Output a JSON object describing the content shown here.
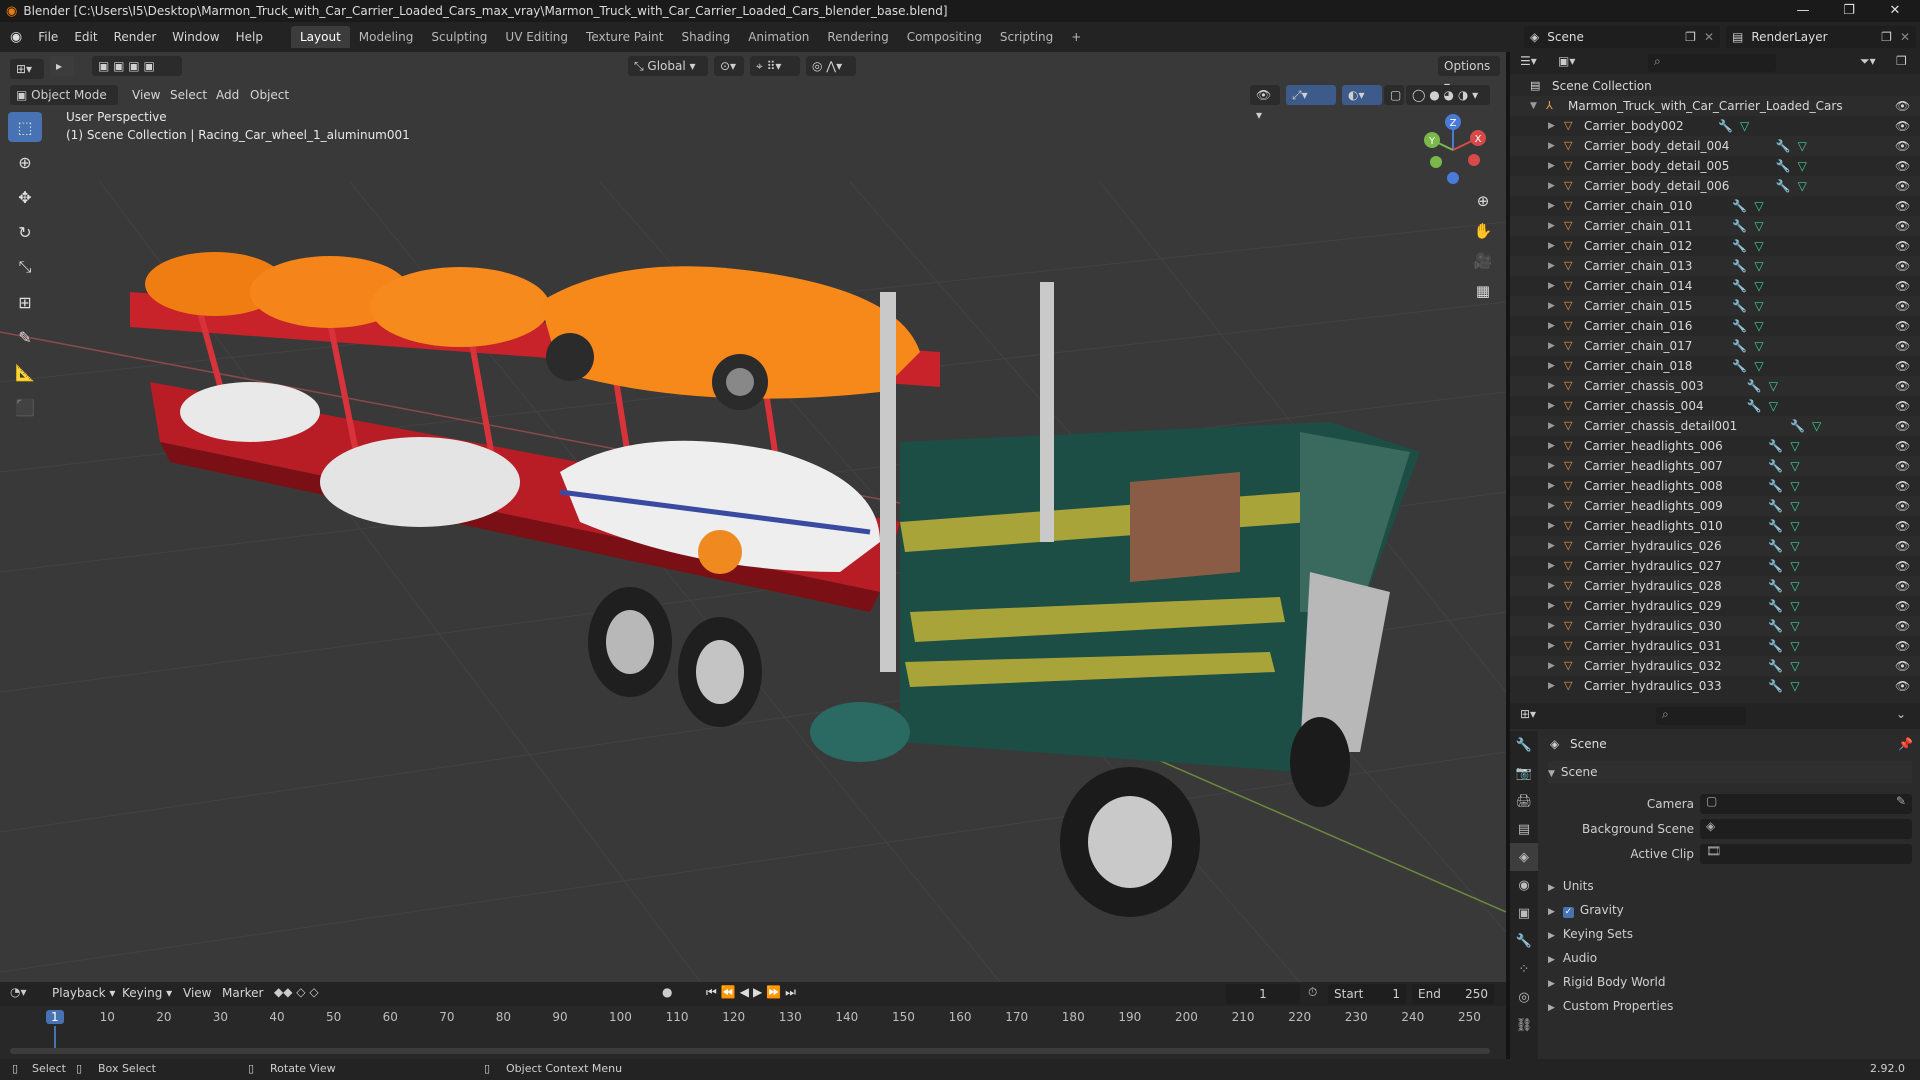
{
  "titlebar": {
    "title": "Blender [C:\\Users\\I5\\Desktop\\Marmon_Truck_with_Car_Carrier_Loaded_Cars_max_vray\\Marmon_Truck_with_Car_Carrier_Loaded_Cars_blender_base.blend]",
    "minimize": "—",
    "restore": "❐",
    "close": "✕"
  },
  "menu": [
    "File",
    "Edit",
    "Render",
    "Window",
    "Help"
  ],
  "workspaces": [
    "Layout",
    "Modeling",
    "Sculpting",
    "UV Editing",
    "Texture Paint",
    "Shading",
    "Animation",
    "Rendering",
    "Compositing",
    "Scripting"
  ],
  "active_workspace": "Layout",
  "add_workspace": "+",
  "scene_selector": {
    "label": "Scene",
    "layer": "RenderLayer"
  },
  "viewport": {
    "mode": "Object Mode",
    "menus": [
      "View",
      "Select",
      "Add",
      "Object"
    ],
    "transform_orientation": "Global",
    "options": "Options",
    "perspective": "User Perspective",
    "context": "(1) Scene Collection | Racing_Car_wheel_1_aluminum001",
    "gizmo": {
      "x": "X",
      "y": "Y",
      "z": "Z"
    }
  },
  "outliner": {
    "root": "Scene Collection",
    "collection": "Marmon_Truck_with_Car_Carrier_Loaded_Cars",
    "items": [
      "Carrier_body002",
      "Carrier_body_detail_004",
      "Carrier_body_detail_005",
      "Carrier_body_detail_006",
      "Carrier_chain_010",
      "Carrier_chain_011",
      "Carrier_chain_012",
      "Carrier_chain_013",
      "Carrier_chain_014",
      "Carrier_chain_015",
      "Carrier_chain_016",
      "Carrier_chain_017",
      "Carrier_chain_018",
      "Carrier_chassis_003",
      "Carrier_chassis_004",
      "Carrier_chassis_detail001",
      "Carrier_headlights_006",
      "Carrier_headlights_007",
      "Carrier_headlights_008",
      "Carrier_headlights_009",
      "Carrier_headlights_010",
      "Carrier_hydraulics_026",
      "Carrier_hydraulics_027",
      "Carrier_hydraulics_028",
      "Carrier_hydraulics_029",
      "Carrier_hydraulics_030",
      "Carrier_hydraulics_031",
      "Carrier_hydraulics_032",
      "Carrier_hydraulics_033"
    ]
  },
  "properties": {
    "breadcrumb": "Scene",
    "panel": "Scene",
    "fields": {
      "camera": "Camera",
      "background_scene": "Background Scene",
      "active_clip": "Active Clip"
    },
    "subpanels": [
      "Units",
      "Gravity",
      "Keying Sets",
      "Audio",
      "Rigid Body World",
      "Custom Properties"
    ],
    "gravity_checked": true
  },
  "timeline": {
    "menus": [
      "Playback",
      "Keying",
      "View",
      "Marker"
    ],
    "current_frame": "1",
    "start_label": "Start",
    "start": "1",
    "end_label": "End",
    "end": "250",
    "ticks": [
      "1",
      "10",
      "20",
      "30",
      "40",
      "50",
      "60",
      "70",
      "80",
      "90",
      "100",
      "110",
      "120",
      "130",
      "140",
      "150",
      "160",
      "170",
      "180",
      "190",
      "200",
      "210",
      "220",
      "230",
      "240",
      "250"
    ]
  },
  "statusbar": {
    "select": "Select",
    "box_select": "Box Select",
    "rotate_view": "Rotate View",
    "context_menu": "Object Context Menu",
    "version": "2.92.0"
  }
}
